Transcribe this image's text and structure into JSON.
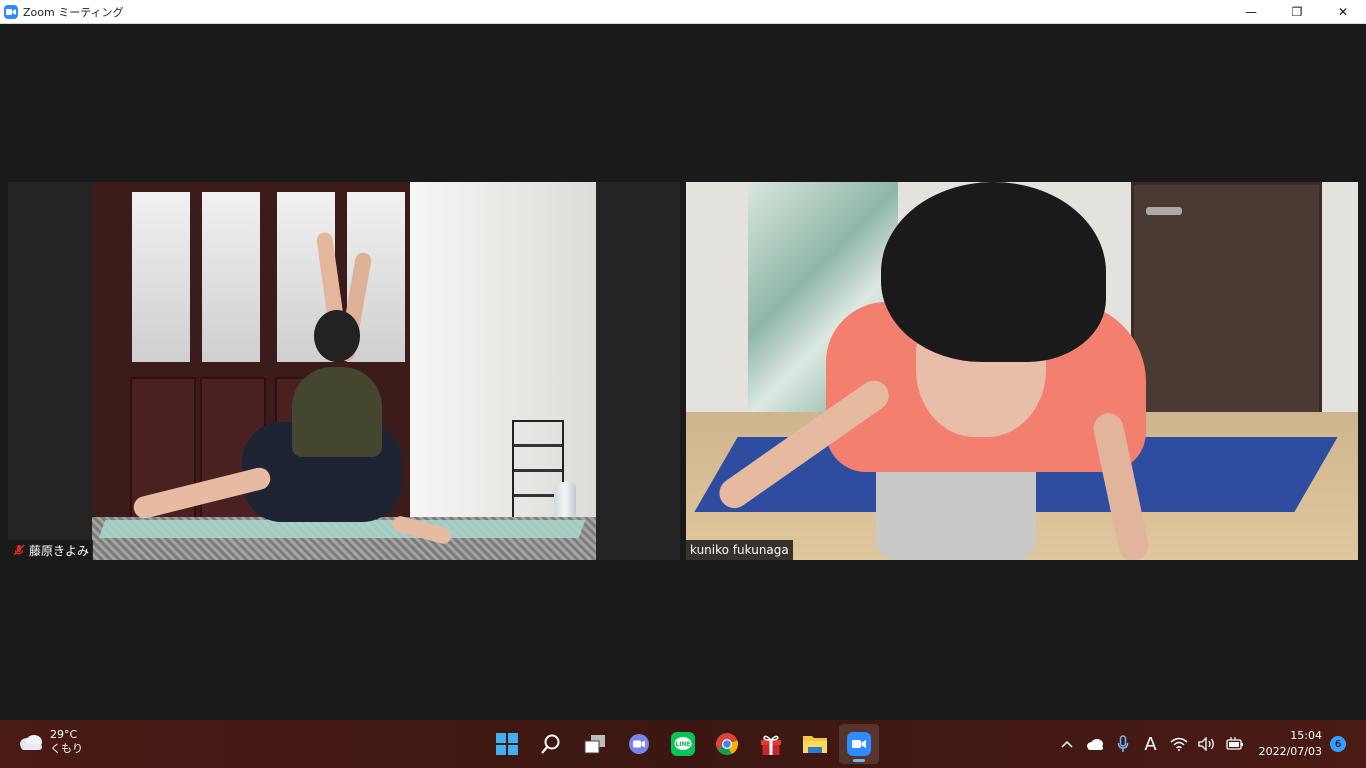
{
  "window": {
    "title": "Zoom ミーティング",
    "minimize_glyph": "—",
    "maximize_glyph": "❐",
    "close_glyph": "✕"
  },
  "participants": [
    {
      "name": "藤原きよみ",
      "muted": true
    },
    {
      "name": "kuniko fukunaga",
      "muted": false
    }
  ],
  "taskbar": {
    "weather": {
      "temp": "29°C",
      "condition": "くもり"
    },
    "apps": [
      {
        "id": "start",
        "icon": "windows-start-icon"
      },
      {
        "id": "search",
        "icon": "search-icon"
      },
      {
        "id": "task-view",
        "icon": "task-view-icon"
      },
      {
        "id": "teams-chat",
        "icon": "chat-icon"
      },
      {
        "id": "line",
        "icon": "line-icon",
        "label": "LINE"
      },
      {
        "id": "chrome",
        "icon": "chrome-icon"
      },
      {
        "id": "gift",
        "icon": "gift-icon"
      },
      {
        "id": "file-explorer",
        "icon": "folder-icon"
      },
      {
        "id": "zoom",
        "icon": "zoom-icon",
        "active": true
      }
    ],
    "tray": {
      "chevron": "^",
      "ime": "A",
      "time": "15:04",
      "date": "2022/07/03",
      "notifications": "6"
    }
  },
  "colors": {
    "zoom_blue": "#2d8cff",
    "meeting_bg": "#1a1a1a",
    "taskbar_bg": "#3c1712",
    "mute_red": "#e02828",
    "line_green": "#06c755"
  }
}
